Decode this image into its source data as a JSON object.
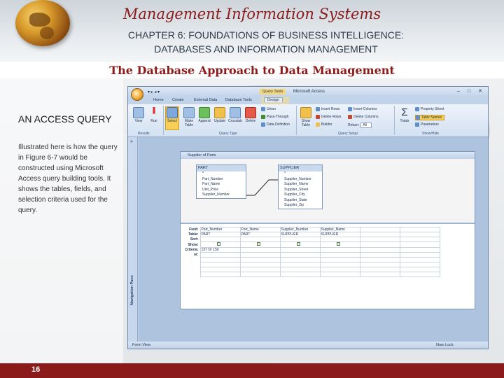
{
  "slide": {
    "title": "Management Information Systems",
    "chapter_line1": "CHAPTER 6: FOUNDATIONS OF BUSINESS INTELLIGENCE:",
    "chapter_line2": "DATABASES AND INFORMATION MANAGEMENT",
    "subtitle": "The Database Approach to Data Management",
    "heading": "AN ACCESS QUERY",
    "body": "Illustrated here is how the query in Figure 6-7 would be constructed using Microsoft Access query building tools. It shows the tables, fields, and selection criteria used for the query.",
    "page_number": "16"
  },
  "access": {
    "qat": "▾ ▸ ◂ ▾",
    "query_tools": "Query Tools",
    "app_title": "Microsoft Access",
    "tabs": [
      "Home",
      "Create",
      "External Data",
      "Database Tools",
      "Design"
    ],
    "ribbon": {
      "view": "View",
      "run": "Run",
      "select": "Select",
      "make_table": "Make Table",
      "append": "Append",
      "update": "Update",
      "crosstab": "Crosstab",
      "delete": "Delete",
      "union": "Union",
      "pass_through": "Pass-Through",
      "data_definition": "Data Definition",
      "show_table": "Show Table",
      "insert_rows": "Insert Rows",
      "delete_rows": "Delete Rows",
      "builder": "Builder",
      "insert_columns": "Insert Columns",
      "delete_columns": "Delete Columns",
      "return_label": "Return:",
      "return_value": "All",
      "totals": "Totals",
      "property_sheet": "Property Sheet",
      "table_names": "Table Names",
      "parameters": "Parameters",
      "groups": [
        "Results",
        "Query Type",
        "Query Setup",
        "Show/Hide"
      ]
    },
    "nav_pane": "Navigation Pane",
    "status_left": "Form View",
    "status_right": "Num Lock",
    "query_title": "Supplier of Parts",
    "table_part": {
      "name": "PART",
      "fields": [
        "*",
        "Part_Number",
        "Part_Name",
        "Unit_Price",
        "Supplier_Number"
      ]
    },
    "table_supplier": {
      "name": "SUPPLIER",
      "fields": [
        "*",
        "Supplier_Number",
        "Supplier_Name",
        "Supplier_Street",
        "Supplier_City",
        "Supplier_State",
        "Supplier_Zip"
      ]
    },
    "grid": {
      "row_labels": [
        "Field:",
        "Table:",
        "Sort:",
        "Show:",
        "Criteria:",
        "or:"
      ],
      "columns": [
        {
          "field": "Part_Number",
          "table": "PART",
          "criteria": "137 Or 150"
        },
        {
          "field": "Part_Name",
          "table": "PART",
          "criteria": ""
        },
        {
          "field": "Supplier_Number",
          "table": "SUPPLIER",
          "criteria": ""
        },
        {
          "field": "Supplier_Name",
          "table": "SUPPLIER",
          "criteria": ""
        }
      ]
    }
  },
  "colors": {
    "title": "#8b1a1a",
    "footer": "#8b1a1a",
    "ribbon_highlight": "#f6cf57"
  }
}
